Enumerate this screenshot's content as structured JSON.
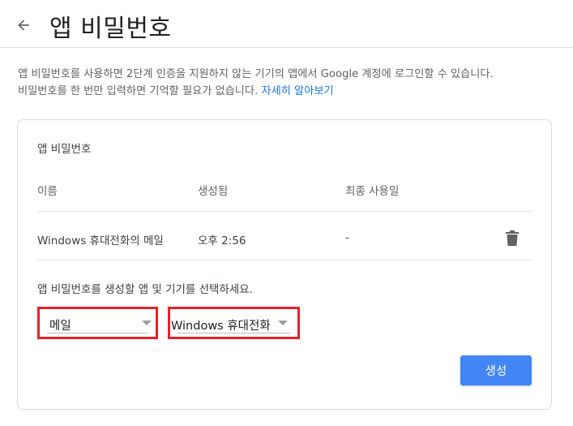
{
  "header": {
    "back_icon": "arrow-left-icon",
    "title": "앱 비밀번호"
  },
  "intro": {
    "line1": "앱 비밀번호를 사용하면 2단계 인증을 지원하지 않는 기기의 앱에서 Google 계정에 로그인할 수 있습니다.",
    "line2": "비밀번호를 한 번만 입력하면 기억할 필요가 없습니다.",
    "link": "자세히 알아보기"
  },
  "card": {
    "title": "앱 비밀번호",
    "columns": [
      "이름",
      "생성됨",
      "최종 사용일"
    ],
    "rows": [
      {
        "name": "Windows 휴대전화의 메일",
        "created": "오후 2:56",
        "last_used": "-",
        "delete_icon": "trash-icon"
      }
    ],
    "select_prompt": "앱 비밀번호를 생성할 앱 및 기기를 선택하세요.",
    "app_select": {
      "value": "메일"
    },
    "device_select": {
      "value": "Windows 휴대전화"
    },
    "generate_label": "생성"
  },
  "colors": {
    "accent": "#4285f4",
    "link": "#1a73e8",
    "highlight_border": "#e8202a"
  }
}
